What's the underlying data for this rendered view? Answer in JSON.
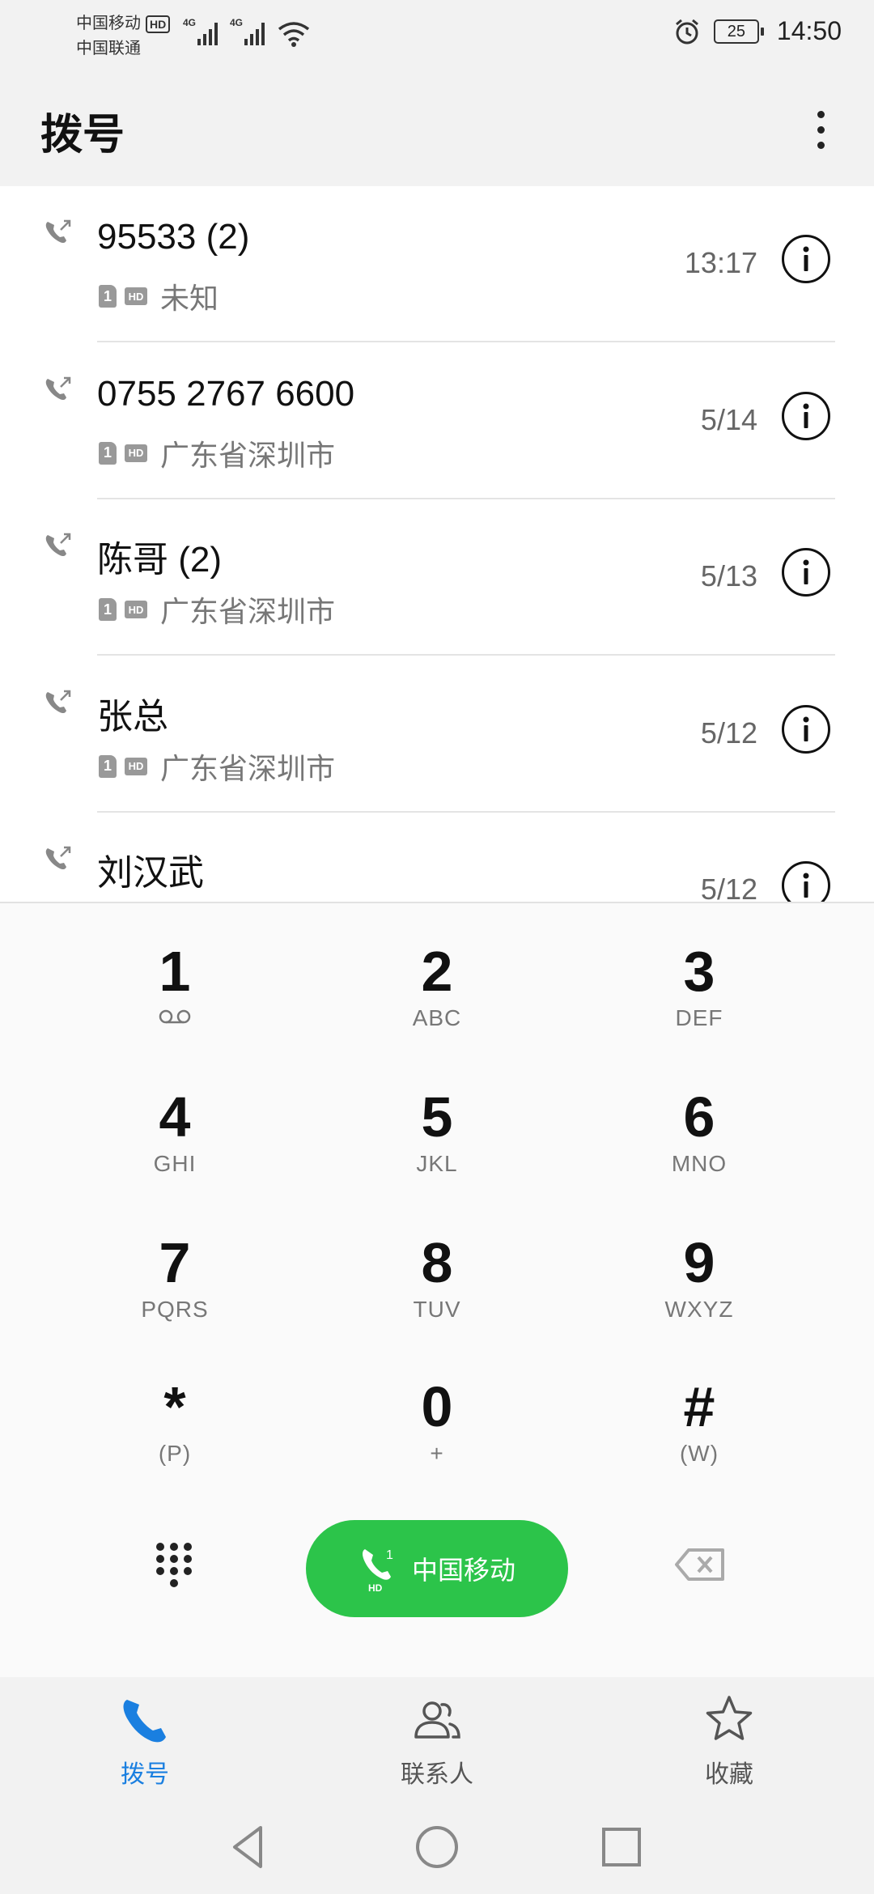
{
  "status_bar": {
    "carrier_primary": "中国移动",
    "carrier_primary_badge": "HD",
    "carrier_secondary": "中国联通",
    "network_type_1": "4G",
    "network_type_2": "4G",
    "battery_level": "25",
    "time": "14:50"
  },
  "header": {
    "title": "拨号"
  },
  "call_log": [
    {
      "name": "95533 (2)",
      "sim": "1",
      "hd": "HD",
      "location": "未知",
      "time": "13:17"
    },
    {
      "name": "0755 2767 6600",
      "sim": "1",
      "hd": "HD",
      "location": "广东省深圳市",
      "time": "5/14"
    },
    {
      "name": "陈哥 (2)",
      "sim": "1",
      "hd": "HD",
      "location": "广东省深圳市",
      "time": "5/13"
    },
    {
      "name": "张总",
      "sim": "1",
      "hd": "HD",
      "location": "广东省深圳市",
      "time": "5/12"
    },
    {
      "name": "刘汉武",
      "sim": "",
      "hd": "",
      "location": "",
      "time": "5/12"
    }
  ],
  "keypad": [
    {
      "digit": "1",
      "letters": "voicemail-icon"
    },
    {
      "digit": "2",
      "letters": "ABC"
    },
    {
      "digit": "3",
      "letters": "DEF"
    },
    {
      "digit": "4",
      "letters": "GHI"
    },
    {
      "digit": "5",
      "letters": "JKL"
    },
    {
      "digit": "6",
      "letters": "MNO"
    },
    {
      "digit": "7",
      "letters": "PQRS"
    },
    {
      "digit": "8",
      "letters": "TUV"
    },
    {
      "digit": "9",
      "letters": "WXYZ"
    },
    {
      "digit": "*",
      "letters": "(P)"
    },
    {
      "digit": "0",
      "letters": "+"
    },
    {
      "digit": "#",
      "letters": "(W)"
    }
  ],
  "call_button": {
    "label": "中国移动",
    "sim": "1",
    "hd": "HD",
    "color": "#2cc44a"
  },
  "bottom_nav": [
    {
      "label": "拨号",
      "icon": "phone-icon",
      "active": true
    },
    {
      "label": "联系人",
      "icon": "contacts-icon",
      "active": false
    },
    {
      "label": "收藏",
      "icon": "star-icon",
      "active": false
    }
  ],
  "colors": {
    "accent": "#1a7fe0",
    "inactive": "#555555"
  }
}
